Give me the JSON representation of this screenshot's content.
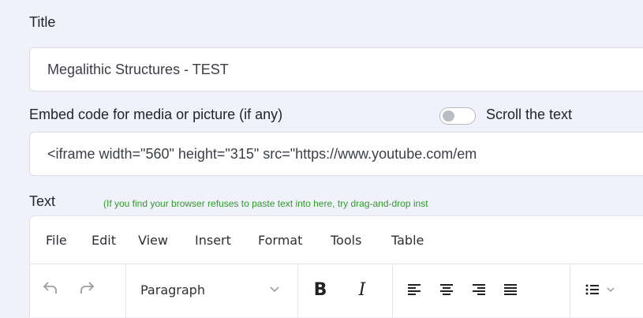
{
  "title_label": "Title",
  "title_value": "Megalithic Structures - TEST",
  "embed_label": "Embed code for media or picture (if any)",
  "scroll_label": "Scroll the text",
  "embed_value": "<iframe width=\"560\" height=\"315\" src=\"https://www.youtube.com/em",
  "text_label": "Text",
  "text_hint": "(If you find your browser refuses to paste text into here, try drag-and-drop inst",
  "menu": [
    "File",
    "Edit",
    "View",
    "Insert",
    "Format",
    "Tools",
    "Table"
  ],
  "toolbar": {
    "block_format": "Paragraph",
    "bold": "B",
    "italic": "I"
  },
  "colors": {
    "background": "#f1f1fb",
    "hint": "#2e9b29",
    "text": "#212529"
  }
}
